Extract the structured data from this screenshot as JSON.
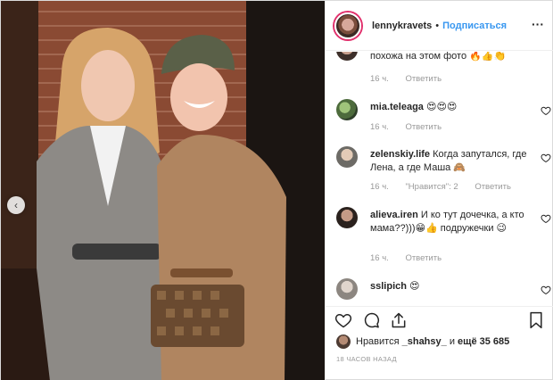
{
  "header": {
    "username": "lennykravets",
    "separator": "•",
    "follow_label": "Подписаться",
    "more_label": "···"
  },
  "photo": {
    "prev_label": "‹"
  },
  "partial_comment": {
    "text": "похожа на этом фото 🔥👍👏",
    "time": "16 ч.",
    "reply": "Ответить"
  },
  "comments": [
    {
      "username": "mia.teleaga",
      "text": "😍😍😍",
      "time": "16 ч.",
      "likes": "",
      "reply": "Ответить"
    },
    {
      "username": "zelenskiy.life",
      "text": "Когда запутался, где Лена, а где Маша 🙈",
      "time": "16 ч.",
      "likes": "\"Нравится\": 2",
      "reply": "Ответить"
    },
    {
      "username": "alieva.iren",
      "text": "И ко тут дочечка, а кто мама??)))😁👍 подружечки 😉",
      "time": "16 ч.",
      "likes": "",
      "reply": "Ответить"
    },
    {
      "username": "sslipich",
      "text": "😍"
    }
  ],
  "likes": {
    "prefix": "Нравится",
    "user": "_shahsy_",
    "middle": "и",
    "count": "ещё 35 685"
  },
  "timestamp": "18 ЧАСОВ НАЗАД",
  "icons": {
    "more": "more-icon",
    "heart": "heart-icon",
    "comment": "comment-icon",
    "share": "share-icon",
    "bookmark": "bookmark-icon",
    "prev": "chevron-left-icon"
  },
  "colors": {
    "follow": "#3897f0",
    "meta": "#999999",
    "border": "#efefef",
    "ring": "#e1306c"
  }
}
